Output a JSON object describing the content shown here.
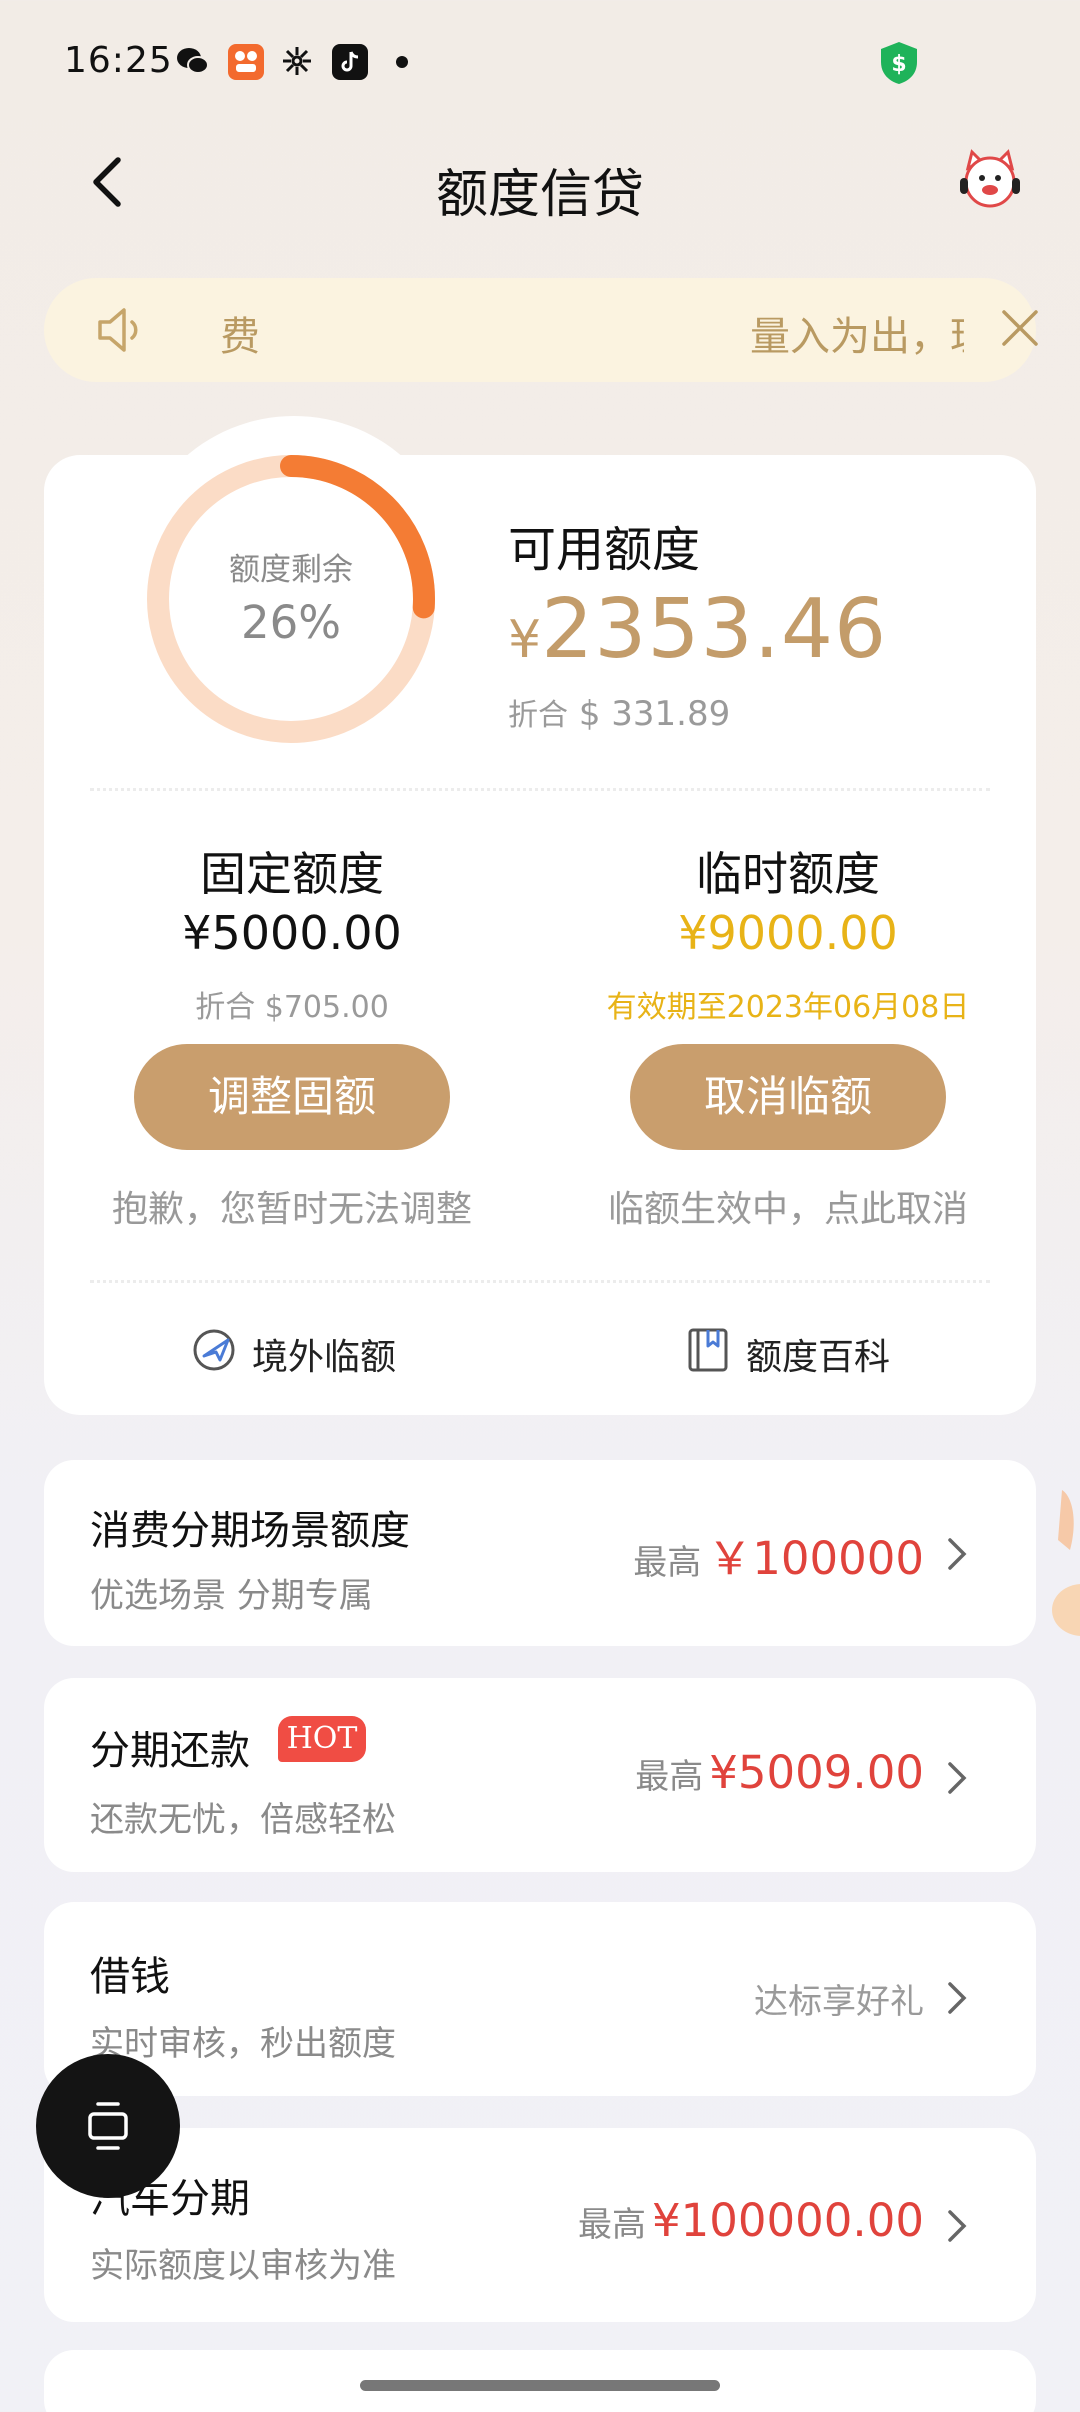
{
  "status_bar": {
    "time": "16:25",
    "icons": [
      "wechat-icon",
      "app-icon",
      "flower-icon",
      "tiktok-icon",
      "dot-icon",
      "shield-dollar-icon"
    ]
  },
  "header": {
    "title": "额度信贷",
    "back_icon": "chevron-left-icon",
    "service_icon": "customer-service-icon"
  },
  "notice": {
    "left_text": "费",
    "right_text": "量入为出，理性消费",
    "icon": "speaker-icon",
    "close_icon": "close-icon"
  },
  "quota": {
    "ring_label": "额度剩余",
    "ring_percent": "26%",
    "ring_fraction": 0.26,
    "available_label": "可用额度",
    "currency_symbol": "¥",
    "available_amount": "2353.46",
    "converted_label": "折合",
    "converted_symbol": "$",
    "converted_amount": "331.89",
    "fixed": {
      "label": "固定额度",
      "amount": "¥5000.00",
      "sub": "折合 $705.00",
      "button": "调整固额",
      "hint": "抱歉，您暂时无法调整"
    },
    "temporary": {
      "label": "临时额度",
      "amount": "¥9000.00",
      "sub": "有效期至2023年06月08日",
      "button": "取消临额",
      "hint": "临额生效中，点此取消"
    },
    "shortcuts": {
      "overseas": "境外临额",
      "encyclopedia": "额度百科"
    }
  },
  "list": [
    {
      "title": "消费分期场景额度",
      "sub": "优选场景 分期专属",
      "prefix": "最高",
      "amount": "￥100000"
    },
    {
      "title": "分期还款",
      "badge": "HOT",
      "sub": "还款无忧，倍感轻松",
      "prefix": "最高",
      "amount": "¥5009.00"
    },
    {
      "title": "借钱",
      "sub": "实时审核，秒出额度",
      "right_text": "达标享好礼"
    },
    {
      "title": "汽车分期",
      "sub": "实际额度以审核为准",
      "prefix": "最高",
      "amount": "¥100000.00"
    }
  ],
  "colors": {
    "gold": "#c39c6a",
    "button": "#c99e6d",
    "temp_gold": "#e8b317",
    "red": "#e0433c",
    "ring_bg": "#fbdcc6",
    "ring_fg": "#f47c34"
  }
}
